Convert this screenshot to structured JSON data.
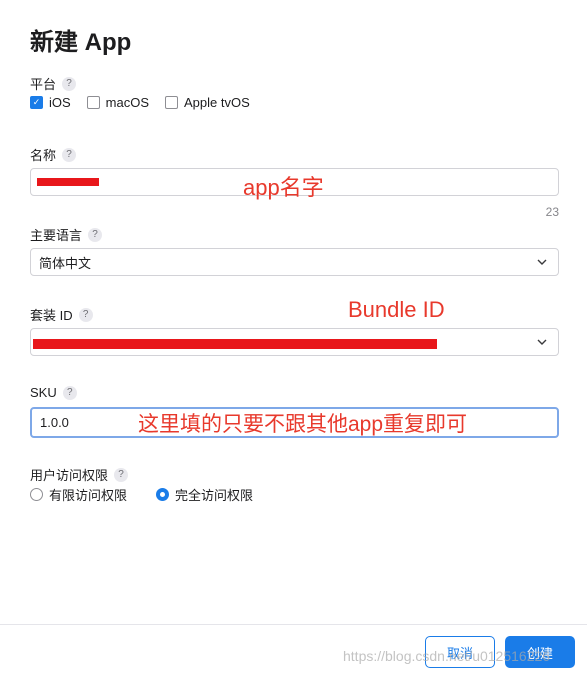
{
  "dialog": {
    "title": "新建 App"
  },
  "platform": {
    "label": "平台",
    "help": "?",
    "options": [
      {
        "label": "iOS",
        "checked": true
      },
      {
        "label": "macOS",
        "checked": false
      },
      {
        "label": "Apple tvOS",
        "checked": false
      }
    ]
  },
  "name": {
    "label": "名称",
    "help": "?",
    "counter": "23",
    "annotation": "app名字"
  },
  "language": {
    "label": "主要语言",
    "help": "?",
    "value": "简体中文"
  },
  "bundle": {
    "label": "套装 ID",
    "help": "?",
    "annotation": "Bundle ID"
  },
  "sku": {
    "label": "SKU",
    "help": "?",
    "value": "1.0.0",
    "annotation": "这里填的只要不跟其他app重复即可"
  },
  "access": {
    "label": "用户访问权限",
    "help": "?",
    "options": [
      {
        "label": "有限访问权限",
        "selected": false
      },
      {
        "label": "完全访问权限",
        "selected": true
      }
    ]
  },
  "footer": {
    "cancel_label": "取消",
    "create_label": "创建"
  },
  "watermark": "https://blog.csdn.net/u012516226",
  "colors": {
    "accent": "#1a7ce8",
    "annotation_red": "#e8392c",
    "redaction": "#e8171b"
  }
}
